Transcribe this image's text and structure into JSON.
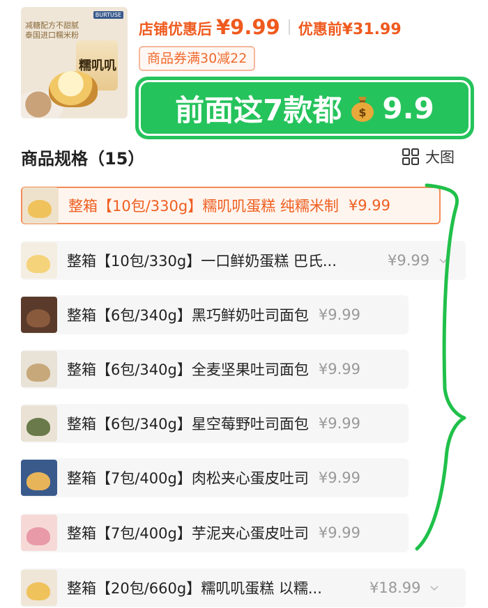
{
  "header": {
    "after_label": "店铺优惠后",
    "after_price": "¥9.99",
    "before_label": "优惠前",
    "before_price": "¥31.99",
    "coupon": "商品券满30减22",
    "thumb": {
      "headline_1": "减糖配方不甜腻",
      "headline_2": "泰国进口糯米粉",
      "brand": "BURTUSE",
      "product_text": "糯叽叽"
    }
  },
  "banner": {
    "text": "前面这7款都",
    "bag_icon": "money-bag-icon",
    "price": "9.9"
  },
  "spec": {
    "title": "商品规格（15）",
    "view_label": "大图",
    "view_icon": "grid-icon"
  },
  "skus": [
    {
      "name": "整箱【10包/330g】糯叽叽蛋糕 纯糯米制",
      "price": "¥9.99",
      "selected": true
    },
    {
      "name": "整箱【10包/330g】一口鲜奶蛋糕 巴氏...",
      "price": "¥9.99",
      "selected": false
    },
    {
      "name": "整箱【6包/340g】黑巧鲜奶吐司面包",
      "price": "¥9.99",
      "selected": false
    },
    {
      "name": "整箱【6包/340g】全麦坚果吐司面包",
      "price": "¥9.99",
      "selected": false
    },
    {
      "name": "整箱【6包/340g】星空莓野吐司面包",
      "price": "¥9.99",
      "selected": false
    },
    {
      "name": "整箱【7包/400g】肉松夹心蛋皮吐司",
      "price": "¥9.99",
      "selected": false
    },
    {
      "name": "整箱【7包/400g】芋泥夹心蛋皮吐司",
      "price": "¥9.99",
      "selected": false
    },
    {
      "name": "整箱【20包/660g】糯叽叽蛋糕 以糯...",
      "price": "¥18.99",
      "selected": false
    }
  ],
  "colors": {
    "accent": "#ef5a1e",
    "banner_green": "#25c35c",
    "annotation_green": "#20c04a"
  }
}
